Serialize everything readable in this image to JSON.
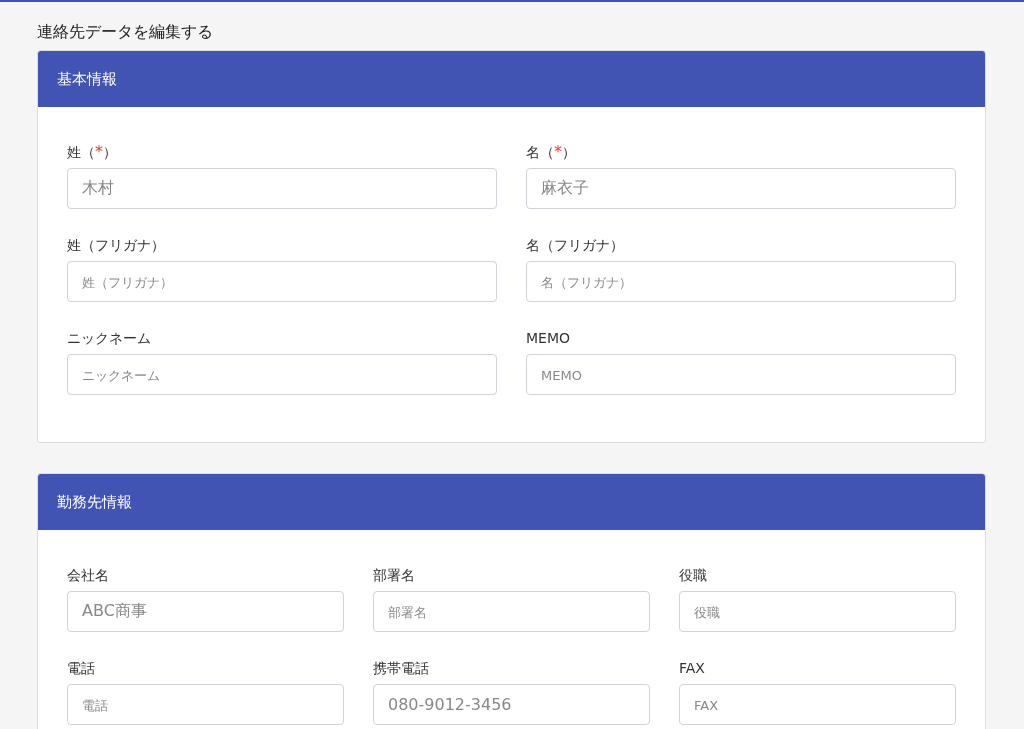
{
  "page_title": "連絡先データを編集する",
  "sections": [
    {
      "title": "基本情報",
      "kind": "two_column",
      "fields": [
        {
          "label": "姓（",
          "required_mark": "*",
          "label_tail": "）",
          "value": "木村"
        },
        {
          "label": "名（",
          "required_mark": "*",
          "label_tail": "）",
          "value": "麻衣子"
        },
        {
          "label": "姓（フリガナ）",
          "placeholder": "姓（フリガナ）"
        },
        {
          "label": "名（フリガナ）",
          "placeholder": "名（フリガナ）"
        },
        {
          "label": "ニックネーム",
          "placeholder": "ニックネーム"
        },
        {
          "label": "MEMO",
          "placeholder": "MEMO"
        }
      ]
    },
    {
      "title": "勤務先情報",
      "kind": "three_column",
      "fields": [
        {
          "label": "会社名",
          "value": "ABC商事"
        },
        {
          "label": "部署名",
          "placeholder": "部署名"
        },
        {
          "label": "役職",
          "placeholder": "役職"
        },
        {
          "label": "電話",
          "placeholder": "電話"
        },
        {
          "label": "携帯電話",
          "value": "080-9012-3456"
        },
        {
          "label": "FAX",
          "placeholder": "FAX"
        }
      ]
    }
  ]
}
